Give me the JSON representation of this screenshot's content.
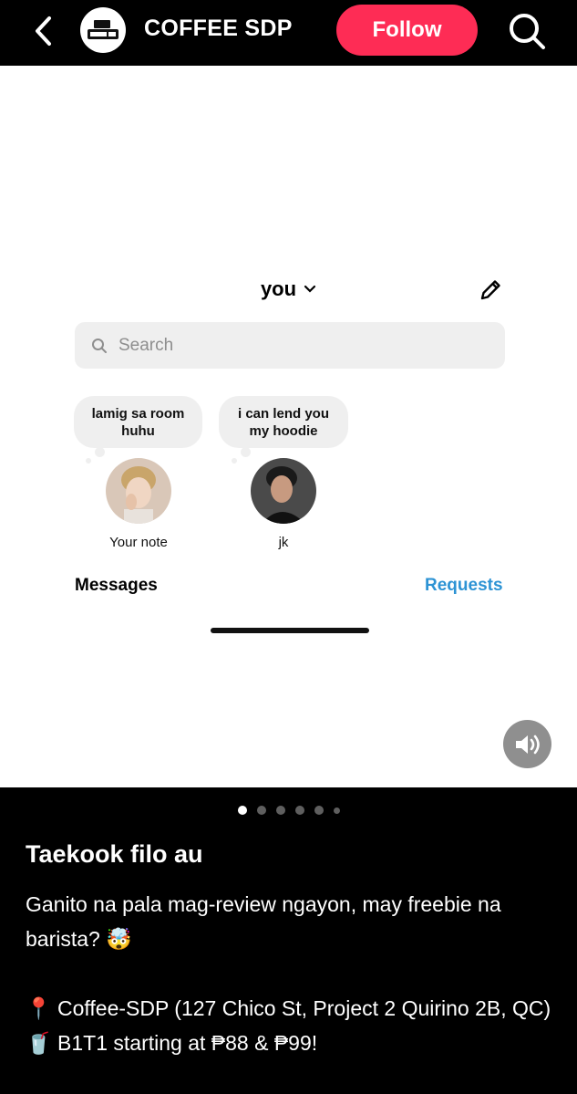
{
  "header": {
    "account_name": "COFFEE SDP",
    "follow_label": "Follow",
    "logo_icon": "coffee-sdp-logo"
  },
  "dm_screenshot": {
    "username": "you",
    "search_placeholder": "Search",
    "notes": [
      {
        "text": "lamig sa room huhu",
        "label": "Your note"
      },
      {
        "text": "i can lend you my hoodie",
        "label": "jk"
      }
    ],
    "tabs": {
      "messages": "Messages",
      "requests": "Requests"
    }
  },
  "carousel": {
    "total": 6,
    "active": 1
  },
  "caption": {
    "title": "Taekook filo au",
    "line1": "Ganito na pala mag-review ngayon, may freebie na barista? 🤯",
    "line2": "📍 Coffee-SDP (127 Chico St, Project 2 Quirino 2B, QC)",
    "line3": "🥤 B1T1 starting at ₱88 & ₱99!"
  },
  "colors": {
    "follow": "#fe2c55",
    "requests": "#2d93d4"
  }
}
